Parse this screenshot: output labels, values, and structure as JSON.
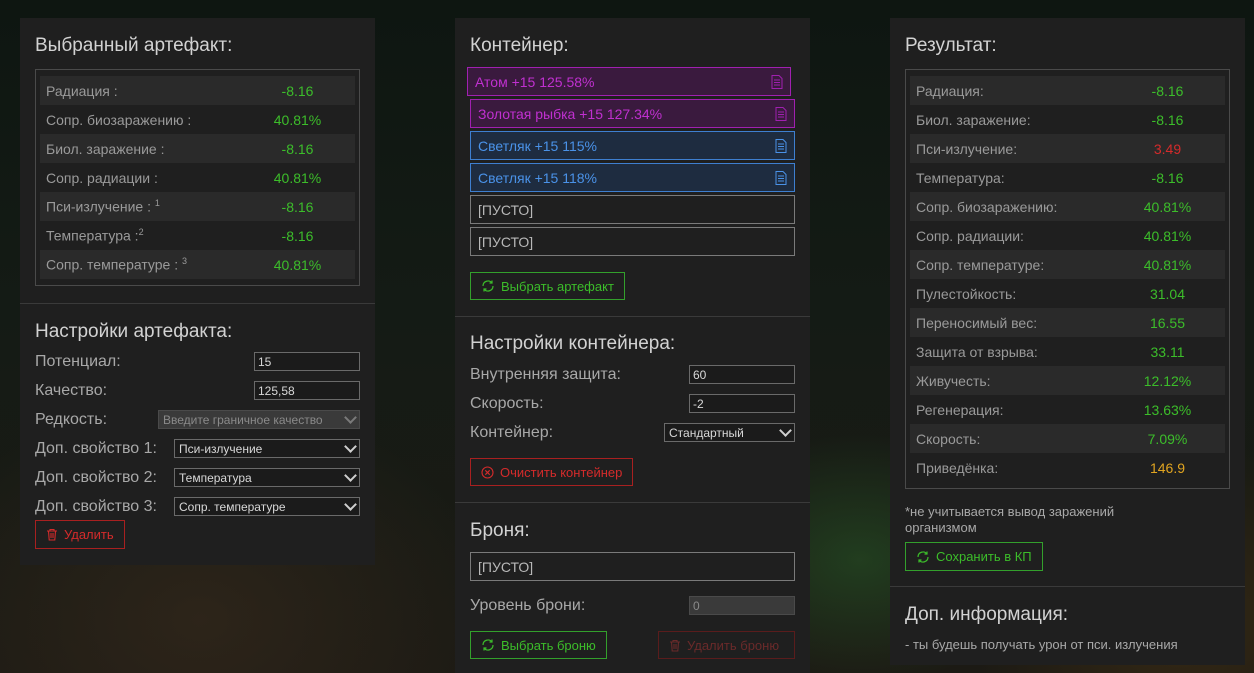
{
  "left": {
    "title": "Выбранный артефакт:",
    "stats": [
      {
        "label": "Радиация :",
        "sup": "",
        "value": "-8.16"
      },
      {
        "label": "Сопр. биозаражению :",
        "sup": "",
        "value": "40.81%"
      },
      {
        "label": "Биол. заражение :",
        "sup": "",
        "value": "-8.16"
      },
      {
        "label": "Сопр. радиации :",
        "sup": "",
        "value": "40.81%"
      },
      {
        "label": "Пси-излучение :",
        "sup": "1",
        "value": "-8.16"
      },
      {
        "label": "Температура :",
        "sup": "2",
        "value": "-8.16"
      },
      {
        "label": "Сопр. температуре :",
        "sup": "3",
        "value": "40.81%"
      }
    ],
    "settings_title": "Настройки артефакта:",
    "potential_label": "Потенциал:",
    "potential_value": "15",
    "quality_label": "Качество:",
    "quality_value": "125,58",
    "rarity_label": "Редкость:",
    "rarity_value": "Введите граничное качество",
    "prop1_label": "Доп. свойство 1:",
    "prop1_value": "Пси-излучение",
    "prop2_label": "Доп. свойство 2:",
    "prop2_value": "Температура",
    "prop3_label": "Доп. свойство 3:",
    "prop3_value": "Сопр. температуре",
    "delete_label": "Удалить"
  },
  "middle": {
    "title": "Контейнер:",
    "slots": [
      {
        "label": "Атом +15 125.58%",
        "style": "purple"
      },
      {
        "label": "Золотая рыбка +15 127.34%",
        "style": "purple"
      },
      {
        "label": "Светляк +15 115%",
        "style": "blue"
      },
      {
        "label": "Светляк +15 118%",
        "style": "blue"
      },
      {
        "label": "[ПУСТО]",
        "style": "empty"
      },
      {
        "label": "[ПУСТО]",
        "style": "empty"
      }
    ],
    "choose_artifact_label": "Выбрать артефакт",
    "settings_title": "Настройки контейнера:",
    "inner_protection_label": "Внутренняя защита:",
    "inner_protection_value": "60",
    "speed_label": "Скорость:",
    "speed_value": "-2",
    "container_label": "Контейнер:",
    "container_value": "Стандартный",
    "clear_label": "Очистить контейнер",
    "armor_title": "Броня:",
    "armor_slot": "[ПУСТО]",
    "armor_level_label": "Уровень брони:",
    "armor_level_value": "0",
    "choose_armor_label": "Выбрать броню",
    "delete_armor_label": "Удалить броню"
  },
  "right": {
    "title": "Результат:",
    "stats": [
      {
        "label": "Радиация:",
        "value": "-8.16",
        "color": "green"
      },
      {
        "label": "Биол. заражение:",
        "value": "-8.16",
        "color": "green"
      },
      {
        "label": "Пси-излучение:",
        "value": "3.49",
        "color": "red"
      },
      {
        "label": "Температура:",
        "value": "-8.16",
        "color": "green"
      },
      {
        "label": "Сопр. биозаражению:",
        "value": "40.81%",
        "color": "green"
      },
      {
        "label": "Сопр. радиации:",
        "value": "40.81%",
        "color": "green"
      },
      {
        "label": "Сопр. температуре:",
        "value": "40.81%",
        "color": "green"
      },
      {
        "label": "Пулестойкость:",
        "value": "31.04",
        "color": "green"
      },
      {
        "label": "Переносимый вес:",
        "value": "16.55",
        "color": "green"
      },
      {
        "label": "Защита от взрыва:",
        "value": "33.11",
        "color": "green"
      },
      {
        "label": "Живучесть:",
        "value": "12.12%",
        "color": "green"
      },
      {
        "label": "Регенерация:",
        "value": "13.63%",
        "color": "green"
      },
      {
        "label": "Скорость:",
        "value": "7.09%",
        "color": "green"
      },
      {
        "label": "Приведёнка:",
        "value": "146.9",
        "color": "orange"
      }
    ],
    "footnote": "*не учитывается вывод заражений организмом",
    "save_label": "Сохранить в КП",
    "info_title": "Доп. информация:",
    "info_text": "- ты будешь получать урон от пси. излучения"
  },
  "colors": {
    "green": "#3cbd2a",
    "red": "#d42b2b",
    "orange": "#e0a420",
    "purple": "#c030d0",
    "blue": "#4a92e8"
  }
}
